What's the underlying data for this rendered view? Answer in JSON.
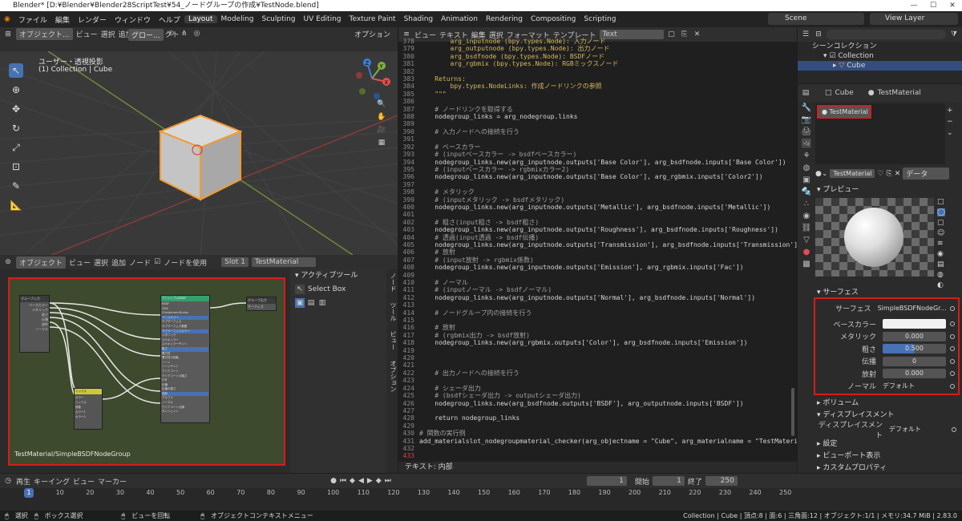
{
  "window": {
    "title": "Blender* [D:¥Blender¥Blender28ScriptTest¥54_ノードグループの作成¥TestNode.blend]",
    "min": "—",
    "max": "☐",
    "close": "✕"
  },
  "menu": [
    "ファイル",
    "編集",
    "レンダー",
    "ウィンドウ",
    "ヘルプ"
  ],
  "workspaces": [
    "Layout",
    "Modeling",
    "Sculpting",
    "UV Editing",
    "Texture Paint",
    "Shading",
    "Animation",
    "Rendering",
    "Compositing",
    "Scripting"
  ],
  "scene": {
    "label": "Scene",
    "view_layer": "View Layer"
  },
  "viewport": {
    "mode": "オブジェクト...",
    "menus": [
      "ビュー",
      "選択",
      "追加",
      "オブジェクト"
    ],
    "orient": "グロー...",
    "options": "オプション",
    "overlay_title": "ユーザー・透視投影",
    "overlay_sub": "(1) Collection | Cube",
    "axes": {
      "x": "X",
      "y": "Y",
      "z": "Z"
    }
  },
  "node_editor": {
    "mode": "オブジェクト",
    "menus": [
      "ビュー",
      "選択",
      "追加",
      "ノード"
    ],
    "use_nodes": "ノードを使用",
    "slot": "Slot 1",
    "material": "TestMaterial",
    "breadcrumb": "TestMaterial/SimpleBSDFNodeGroup",
    "tool_panel": "アクティブツール",
    "select_box": "Select Box",
    "tabs": [
      "ノード",
      "ツール",
      "ビュー",
      "オプション"
    ],
    "group_input": "グループ入力",
    "bsdf": "プリンシプルBSDF",
    "mix": "ミックス",
    "group_output": "グループ出力",
    "bsdf_rows": [
      "BSDF",
      "GGX",
      "Christensen-Burley",
      "ベースカラー",
      "サブサーフェス",
      "サブサーフェス範囲",
      "サブサーフェスカラー",
      "メタリック",
      "スペキュラー",
      "スペキュラーチント",
      "粗さ",
      "異方性",
      "異方性の回転",
      "シーン",
      "シーンチント",
      "クリアコート",
      "クリアコートの粗さ",
      "IOR",
      "伝播",
      "伝播の粗さ",
      "放射",
      "アルファ",
      "ノーマル",
      "クリアコート法線",
      "タンジェント"
    ],
    "mix_rows": [
      "カラー",
      "ミックス",
      "係数",
      "カラー1",
      "カラー2"
    ],
    "input_rows": [
      "ベースカラー",
      "メタリック",
      "粗さ",
      "伝播",
      "放射",
      "ノーマル"
    ],
    "output_rows": [
      "サーフェス"
    ]
  },
  "text_editor": {
    "menus": [
      "ビュー",
      "テキスト",
      "編集",
      "選択",
      "フォーマット",
      "テンプレート"
    ],
    "file": "Text",
    "status": "テキスト: 内部",
    "lines": [
      {
        "n": "378",
        "t": "        arg_inputnode (bpy.types.Node): 入力ノード",
        "c": "#d6b75c"
      },
      {
        "n": "379",
        "t": "        arg_outputnode (bpy.types.Node): 出力ノード",
        "c": "#d6b75c"
      },
      {
        "n": "380",
        "t": "        arg_bsdfnode (bpy.types.Node): BSDFノード",
        "c": "#d6b75c"
      },
      {
        "n": "381",
        "t": "        arg_rgbmix (bpy.types.Node): RGBミックスノード",
        "c": "#d6b75c"
      },
      {
        "n": "382",
        "t": "",
        "c": "#d6d6d6"
      },
      {
        "n": "383",
        "t": "    Returns:",
        "c": "#d6b75c"
      },
      {
        "n": "384",
        "t": "        bpy.types.NodeLinks: 作成ノードリンクの参照",
        "c": "#d6b75c"
      },
      {
        "n": "385",
        "t": "    \"\"\"",
        "c": "#d6b75c"
      },
      {
        "n": "386",
        "t": "",
        "c": "#d6d6d6"
      },
      {
        "n": "387",
        "t": "    # ノードリンクを取得する",
        "c": "#a0a0a0"
      },
      {
        "n": "388",
        "t": "    nodegroup_links = arg_nodegroup.links",
        "c": "#d6d6d6"
      },
      {
        "n": "389",
        "t": "",
        "c": "#d6d6d6"
      },
      {
        "n": "390",
        "t": "    # 入力ノードへの接続を行う",
        "c": "#a0a0a0"
      },
      {
        "n": "391",
        "t": "",
        "c": "#d6d6d6"
      },
      {
        "n": "392",
        "t": "    # ベースカラー",
        "c": "#a0a0a0"
      },
      {
        "n": "393",
        "t": "    # (inputベースカラー -> bsdfベースカラー)",
        "c": "#a0a0a0"
      },
      {
        "n": "394",
        "t": "    nodegroup_links.new(arg_inputnode.outputs['Base Color'], arg_bsdfnode.inputs['Base Color'])",
        "c": "#d6d6d6"
      },
      {
        "n": "395",
        "t": "    # (inputベースカラー -> rgbmixカラー2)",
        "c": "#a0a0a0"
      },
      {
        "n": "396",
        "t": "    nodegroup_links.new(arg_inputnode.outputs['Base Color'], arg_rgbmix.inputs['Color2'])",
        "c": "#d6d6d6"
      },
      {
        "n": "397",
        "t": "",
        "c": "#d6d6d6"
      },
      {
        "n": "398",
        "t": "    # メタリック",
        "c": "#a0a0a0"
      },
      {
        "n": "399",
        "t": "    # (inputメタリック -> bsdfメタリック)",
        "c": "#a0a0a0"
      },
      {
        "n": "400",
        "t": "    nodegroup_links.new(arg_inputnode.outputs['Metallic'], arg_bsdfnode.inputs['Metallic'])",
        "c": "#d6d6d6"
      },
      {
        "n": "401",
        "t": "",
        "c": "#d6d6d6"
      },
      {
        "n": "402",
        "t": "    # 粗さ(input粗さ -> bsdf粗さ)",
        "c": "#a0a0a0"
      },
      {
        "n": "403",
        "t": "    nodegroup_links.new(arg_inputnode.outputs['Roughness'], arg_bsdfnode.inputs['Roughness'])",
        "c": "#d6d6d6"
      },
      {
        "n": "404",
        "t": "    # 透過(input透過 -> bsdf伝播)",
        "c": "#a0a0a0"
      },
      {
        "n": "405",
        "t": "    nodegroup_links.new(arg_inputnode.outputs['Transmission'], arg_bsdfnode.inputs['Transmission'])",
        "c": "#d6d6d6"
      },
      {
        "n": "406",
        "t": "    # 放射",
        "c": "#a0a0a0"
      },
      {
        "n": "407",
        "t": "    # (input放射 -> rgbmix係数)",
        "c": "#a0a0a0"
      },
      {
        "n": "408",
        "t": "    nodegroup_links.new(arg_inputnode.outputs['Emission'], arg_rgbmix.inputs['Fac'])",
        "c": "#d6d6d6"
      },
      {
        "n": "409",
        "t": "",
        "c": "#d6d6d6"
      },
      {
        "n": "410",
        "t": "    # ノーマル",
        "c": "#a0a0a0"
      },
      {
        "n": "411",
        "t": "    # (inputノーマル -> bsdfノーマル)",
        "c": "#a0a0a0"
      },
      {
        "n": "412",
        "t": "    nodegroup_links.new(arg_inputnode.outputs['Normal'], arg_bsdfnode.inputs['Normal'])",
        "c": "#d6d6d6"
      },
      {
        "n": "413",
        "t": "",
        "c": "#d6d6d6"
      },
      {
        "n": "414",
        "t": "    # ノードグループ内の接続を行う",
        "c": "#a0a0a0"
      },
      {
        "n": "415",
        "t": "",
        "c": "#d6d6d6"
      },
      {
        "n": "416",
        "t": "    # 放射",
        "c": "#a0a0a0"
      },
      {
        "n": "417",
        "t": "    # (rgbmix出力 -> bsdf放射)",
        "c": "#a0a0a0"
      },
      {
        "n": "418",
        "t": "    nodegroup_links.new(arg_rgbmix.outputs['Color'], arg_bsdfnode.inputs['Emission'])",
        "c": "#d6d6d6"
      },
      {
        "n": "419",
        "t": "",
        "c": "#d6d6d6"
      },
      {
        "n": "420",
        "t": "",
        "c": "#d6d6d6"
      },
      {
        "n": "421",
        "t": "",
        "c": "#d6d6d6"
      },
      {
        "n": "422",
        "t": "    # 出力ノードへの接続を行う",
        "c": "#a0a0a0"
      },
      {
        "n": "423",
        "t": "",
        "c": "#d6d6d6"
      },
      {
        "n": "424",
        "t": "    # シェーダ出力",
        "c": "#a0a0a0"
      },
      {
        "n": "425",
        "t": "    # (bsdfシェーダ出力 -> outputシェーダ出力)",
        "c": "#a0a0a0"
      },
      {
        "n": "426",
        "t": "    nodegroup_links.new(arg_bsdfnode.outputs['BSDF'], arg_outputnode.inputs['BSDF'])",
        "c": "#d6d6d6"
      },
      {
        "n": "427",
        "t": "",
        "c": "#d6d6d6"
      },
      {
        "n": "428",
        "t": "    return nodegroup_links",
        "c": "#d6d6d6"
      },
      {
        "n": "429",
        "t": "",
        "c": "#d6d6d6"
      },
      {
        "n": "430",
        "t": "# 関数の実行例",
        "c": "#a0a0a0"
      },
      {
        "n": "431",
        "t": "add_materialslot_nodegroupmaterial_checker(arg_objectname = \"Cube\", arg_materialname = \"TestMaterial\")",
        "c": "#d6d6d6"
      },
      {
        "n": "432",
        "t": "",
        "c": "#d6d6d6"
      },
      {
        "n": "433",
        "t": "",
        "c": "#d6d6d6"
      }
    ]
  },
  "outliner": {
    "scene_collection": "シーンコレクション",
    "collection": "Collection",
    "cube": "Cube"
  },
  "properties": {
    "object": "Cube",
    "material_tab": "TestMaterial",
    "slot_name": "TestMaterial",
    "mat_field": "TestMaterial",
    "data_label": "データ",
    "preview": "プレビュー",
    "surface": "サーフェス",
    "rows": [
      {
        "label": "サーフェス",
        "value": "SimpleBSDFNodeGr..."
      },
      {
        "label": "ベースカラー",
        "value": ""
      },
      {
        "label": "メタリック",
        "value": "0.000"
      },
      {
        "label": "粗さ",
        "value": "0.500"
      },
      {
        "label": "伝播",
        "value": "0"
      },
      {
        "label": "放射",
        "value": "0.000"
      },
      {
        "label": "ノーマル",
        "value": "デフォルト"
      }
    ],
    "volume": "ボリューム",
    "displacement": "ディスプレイスメント",
    "disp_label": "ディスプレイスメント",
    "disp_value": "デフォルト",
    "settings": "設定",
    "viewport_display": "ビューポート表示",
    "custom_props": "カスタムプロパティ",
    "roughness_fill": 0.5
  },
  "timeline": {
    "menus": [
      "再生",
      "キーイング",
      "ビュー",
      "マーカー"
    ],
    "current": "1",
    "start_label": "開始",
    "start": "1",
    "end_label": "終了",
    "end": "250",
    "ticks": [
      "0",
      "10",
      "20",
      "30",
      "40",
      "50",
      "60",
      "70",
      "80",
      "90",
      "100",
      "110",
      "120",
      "130",
      "140",
      "150",
      "160",
      "170",
      "180",
      "190",
      "200",
      "210",
      "220",
      "230",
      "240",
      "250"
    ]
  },
  "statusbar": {
    "select": "選択",
    "box_select": "ボックス選択",
    "rotate": "ビューを回転",
    "context": "オブジェクトコンテキストメニュー",
    "info": "Collection | Cube | 頂点:8 | 面:6 | 三角面:12 | オブジェクト:1/1 | メモリ:34.7 MiB | 2.83.0"
  }
}
